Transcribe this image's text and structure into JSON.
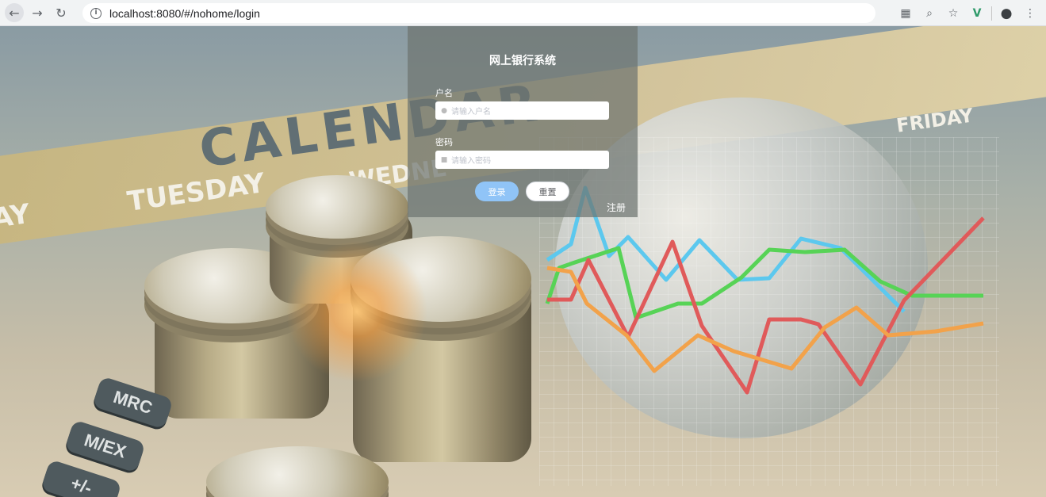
{
  "browser": {
    "url": "localhost:8080/#/nohome/login",
    "icons": [
      "back-arrow-icon",
      "forward-arrow-icon",
      "reload-icon",
      "info-icon",
      "translate-icon",
      "zoom-icon",
      "star-icon",
      "vue-devtools-icon",
      "account-icon",
      "menu-icon"
    ]
  },
  "background": {
    "calendar_word": "CALENDAR",
    "days": {
      "tuesday": "TUESDAY",
      "wednesday": "WEDNE",
      "friday": "FRIDAY",
      "partial": "AY"
    },
    "keys": [
      "MRC",
      "M/EX",
      "+/-"
    ]
  },
  "login": {
    "title": "网上银行系统",
    "username_label": "户名",
    "username_placeholder": "请输入户名",
    "password_label": "密码",
    "password_placeholder": "请输入密码",
    "login_button": "登录",
    "reset_button": "重置",
    "register_link": "注册"
  },
  "colors": {
    "panel": "#6e7470",
    "login_button": "#90c4f7",
    "line_red": "#e05a5a",
    "line_green": "#57d356",
    "line_blue": "#5cc8ee",
    "line_orange": "#f2a24a"
  }
}
